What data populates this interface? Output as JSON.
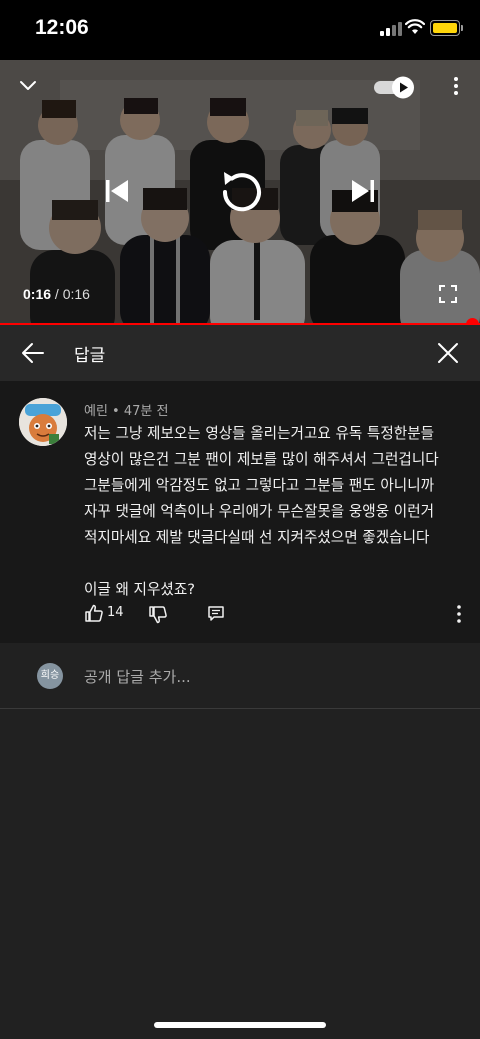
{
  "status_bar": {
    "time": "12:06"
  },
  "player": {
    "elapsed": "0:16",
    "separator": " / ",
    "duration": "0:16",
    "progress_fraction": 1.0,
    "accent_color": "#ff0000",
    "icons": {
      "collapse": "chevron-down-icon",
      "autoplay": "autoplay-toggle-icon",
      "more": "more-vert-icon",
      "prev": "skip-previous-icon",
      "replay": "replay-icon",
      "next": "skip-next-icon",
      "fullscreen": "fullscreen-icon"
    }
  },
  "reply_panel": {
    "title": "답글",
    "icons": {
      "back": "arrow-back-icon",
      "close": "close-icon"
    }
  },
  "comment": {
    "author": "예린",
    "separator": " • ",
    "time_ago": "47분 전",
    "lines": [
      "저는 그냥 제보오는 영상들 올리는거고요 유독 특정한분들",
      "영상이 많은건 그분 팬이 제보를 많이 해주셔서 그런겁니다",
      "그분들에게 악감정도 없고 그렇다고 그분들 팬도 아니니까",
      "자꾸 댓글에 억측이나 우리애가 무슨잘못을 웅앵웅 이런거",
      "적지마세요 제발 댓글다실때 선 지켜주셨으면 좋겠습니다",
      "",
      "이글 왜 지우셨죠?"
    ],
    "like_count": "14",
    "icons": {
      "like": "thumbs-up-icon",
      "dislike": "thumbs-down-icon",
      "reply": "reply-comment-icon",
      "more": "more-vert-icon"
    }
  },
  "add_reply": {
    "user_avatar_text": "희승",
    "placeholder": "공개 답글 추가..."
  }
}
